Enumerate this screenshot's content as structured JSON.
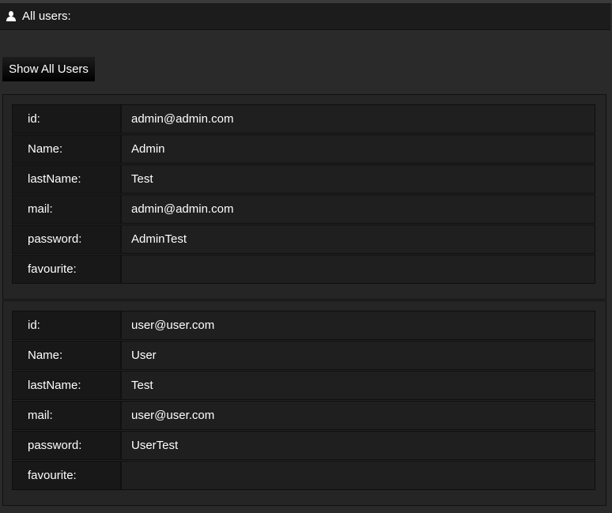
{
  "header": {
    "title": "All users:",
    "icon": "user-icon"
  },
  "show_all_button": "Show All Users",
  "users": [
    {
      "fields": [
        {
          "label": "id:",
          "value": "admin@admin.com"
        },
        {
          "label": "Name:",
          "value": "Admin"
        },
        {
          "label": "lastName:",
          "value": "Test"
        },
        {
          "label": "mail:",
          "value": "admin@admin.com"
        },
        {
          "label": "password:",
          "value": "AdminTest"
        },
        {
          "label": "favourite:",
          "value": ""
        }
      ]
    },
    {
      "fields": [
        {
          "label": "id:",
          "value": "user@user.com"
        },
        {
          "label": "Name:",
          "value": "User"
        },
        {
          "label": "lastName:",
          "value": "Test"
        },
        {
          "label": "mail:",
          "value": "user@user.com"
        },
        {
          "label": "password:",
          "value": "UserTest"
        },
        {
          "label": "favourite:",
          "value": ""
        }
      ]
    }
  ]
}
